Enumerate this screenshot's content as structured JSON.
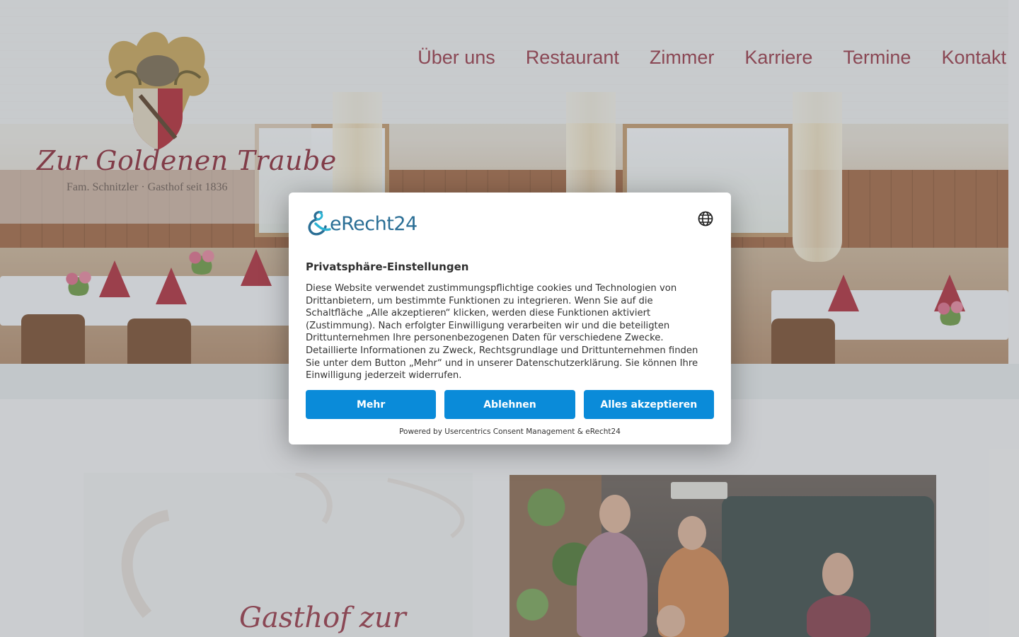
{
  "site": {
    "logo": {
      "title": "Zur Goldenen Traube",
      "subtitle": "Fam. Schnitzler · Gasthof seit 1836"
    },
    "nav": [
      {
        "label": "Über uns"
      },
      {
        "label": "Restaurant"
      },
      {
        "label": "Zimmer"
      },
      {
        "label": "Karriere"
      },
      {
        "label": "Termine"
      },
      {
        "label": "Kontakt"
      }
    ],
    "intro": {
      "heading": "Gasthof zur"
    },
    "accent_color": "#9b3441"
  },
  "consent": {
    "brand": "eRecht24",
    "language_icon": "globe-icon",
    "title": "Privatsphäre-Einstellungen",
    "body": "Diese Website verwendet zustimmungspflichtige cookies und Technologien von Drittanbietern, um bestimmte Funktionen zu integrieren. Wenn Sie auf die Schaltfläche „Alle akzeptieren“ klicken, werden diese Funktionen aktiviert (Zustimmung). Nach erfolgter Einwilligung verarbeiten wir und die beteiligten Drittunternehmen Ihre personenbezogenen Daten für verschiedene Zwecke. Detaillierte Informationen zu Zweck, Rechtsgrundlage und Drittunternehmen finden Sie unter dem Button „Mehr“ und in unserer Datenschutzerklärung. Sie können Ihre Einwilligung jederzeit widerrufen.",
    "buttons": {
      "more": "Mehr",
      "decline": "Ablehnen",
      "accept_all": "Alles akzeptieren"
    },
    "powered_by": "Powered by Usercentrics Consent Management & eRecht24",
    "button_color": "#0a8bd9",
    "brand_color": "#2a6e95"
  }
}
